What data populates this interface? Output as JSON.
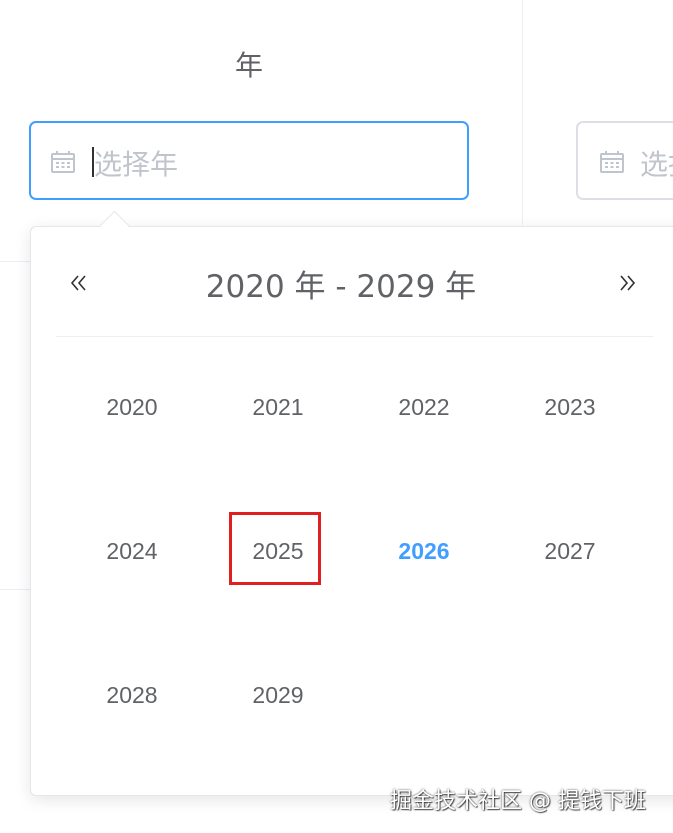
{
  "section": {
    "label": "年"
  },
  "start_input": {
    "placeholder": "选择年",
    "icon": "calendar-icon"
  },
  "end_input": {
    "placeholder": "选择年",
    "icon": "calendar-icon"
  },
  "year_panel": {
    "header": "2020 年 - 2029 年",
    "prev_icon": "double-chevron-left-icon",
    "next_icon": "double-chevron-right-icon",
    "years": [
      "2020",
      "2021",
      "2022",
      "2023",
      "2024",
      "2025",
      "2026",
      "2027",
      "2028",
      "2029"
    ],
    "current_year": "2026",
    "highlighted_year": "2025",
    "accent_color": "#409eff",
    "highlight_color": "#e02020"
  },
  "watermark": "掘金技术社区 @ 提钱下班"
}
